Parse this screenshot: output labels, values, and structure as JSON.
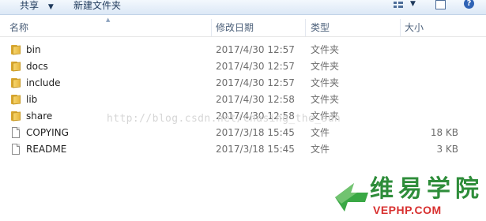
{
  "toolbar": {
    "share_label": "共享",
    "new_folder_label": "新建文件夹"
  },
  "columns": {
    "name": "名称",
    "date": "修改日期",
    "type": "类型",
    "size": "大小"
  },
  "files": [
    {
      "name": "bin",
      "date": "2017/4/30 12:57",
      "type": "文件夹",
      "size": "",
      "icon": "folder-icon"
    },
    {
      "name": "docs",
      "date": "2017/4/30 12:57",
      "type": "文件夹",
      "size": "",
      "icon": "folder-icon"
    },
    {
      "name": "include",
      "date": "2017/4/30 12:57",
      "type": "文件夹",
      "size": "",
      "icon": "folder-icon"
    },
    {
      "name": "lib",
      "date": "2017/4/30 12:58",
      "type": "文件夹",
      "size": "",
      "icon": "folder-icon"
    },
    {
      "name": "share",
      "date": "2017/4/30 12:58",
      "type": "文件夹",
      "size": "",
      "icon": "folder-icon"
    },
    {
      "name": "COPYING",
      "date": "2017/3/18 15:45",
      "type": "文件",
      "size": "18 KB",
      "icon": "file-icon"
    },
    {
      "name": "README",
      "date": "2017/3/18 15:45",
      "type": "文件",
      "size": "3 KB",
      "icon": "file-icon"
    }
  ],
  "watermark": "http://blog.csdn.net/chasing_the_sun",
  "logo": {
    "text_cn": "维易学院",
    "text_en": "VEPHP.COM"
  },
  "colors": {
    "toolbar_text": "#1e395b",
    "folder": "#e8b840",
    "logo_green": "#2e8d3a",
    "logo_red": "#d8302f"
  }
}
